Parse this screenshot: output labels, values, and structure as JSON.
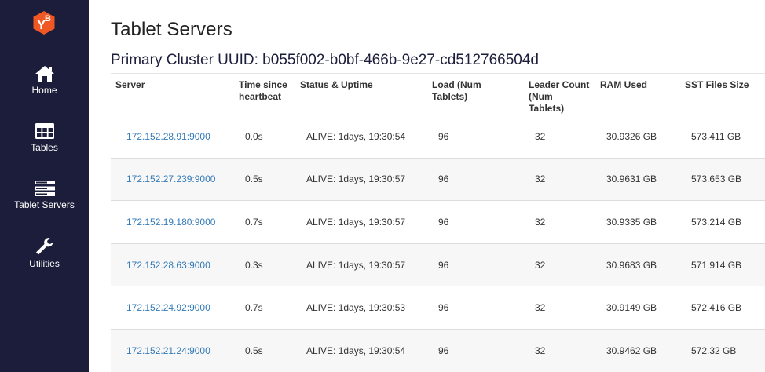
{
  "sidebar": {
    "logo_text": "YB",
    "items": [
      {
        "label": "Home",
        "icon": "home-icon"
      },
      {
        "label": "Tables",
        "icon": "table-icon"
      },
      {
        "label": "Tablet Servers",
        "icon": "server-icon"
      },
      {
        "label": "Utilities",
        "icon": "wrench-icon"
      }
    ],
    "colors": {
      "background": "#1b1d3a",
      "logo": "#ef5824"
    }
  },
  "main": {
    "title": "Tablet Servers",
    "cluster_title": "Primary Cluster UUID: b055f002-b0bf-466b-9e27-cd512766504d",
    "table": {
      "headers": {
        "server": "Server",
        "time": "Time since heartbeat",
        "status": "Status & Uptime",
        "load": "Load (Num Tablets)",
        "leader": "Leader Count (Num Tablets)",
        "ram": "RAM Used",
        "sst": "SST Files Size"
      },
      "rows": [
        {
          "server": "172.152.28.91:9000",
          "time": "0.0s",
          "status": "ALIVE: 1days, 19:30:54",
          "load": "96",
          "leader": "32",
          "ram": "30.9326 GB",
          "sst": "573.411 GB"
        },
        {
          "server": "172.152.27.239:9000",
          "time": "0.5s",
          "status": "ALIVE: 1days, 19:30:57",
          "load": "96",
          "leader": "32",
          "ram": "30.9631 GB",
          "sst": "573.653 GB"
        },
        {
          "server": "172.152.19.180:9000",
          "time": "0.7s",
          "status": "ALIVE: 1days, 19:30:57",
          "load": "96",
          "leader": "32",
          "ram": "30.9335 GB",
          "sst": "573.214 GB"
        },
        {
          "server": "172.152.28.63:9000",
          "time": "0.3s",
          "status": "ALIVE: 1days, 19:30:57",
          "load": "96",
          "leader": "32",
          "ram": "30.9683 GB",
          "sst": "571.914 GB"
        },
        {
          "server": "172.152.24.92:9000",
          "time": "0.7s",
          "status": "ALIVE: 1days, 19:30:53",
          "load": "96",
          "leader": "32",
          "ram": "30.9149 GB",
          "sst": "572.416 GB"
        },
        {
          "server": "172.152.21.24:9000",
          "time": "0.5s",
          "status": "ALIVE: 1days, 19:30:54",
          "load": "96",
          "leader": "32",
          "ram": "30.9462 GB",
          "sst": "572.32 GB"
        }
      ],
      "colors": {
        "link": "#337ab7",
        "alive": "#228b22",
        "stripe": "#f7f7f7"
      }
    }
  }
}
